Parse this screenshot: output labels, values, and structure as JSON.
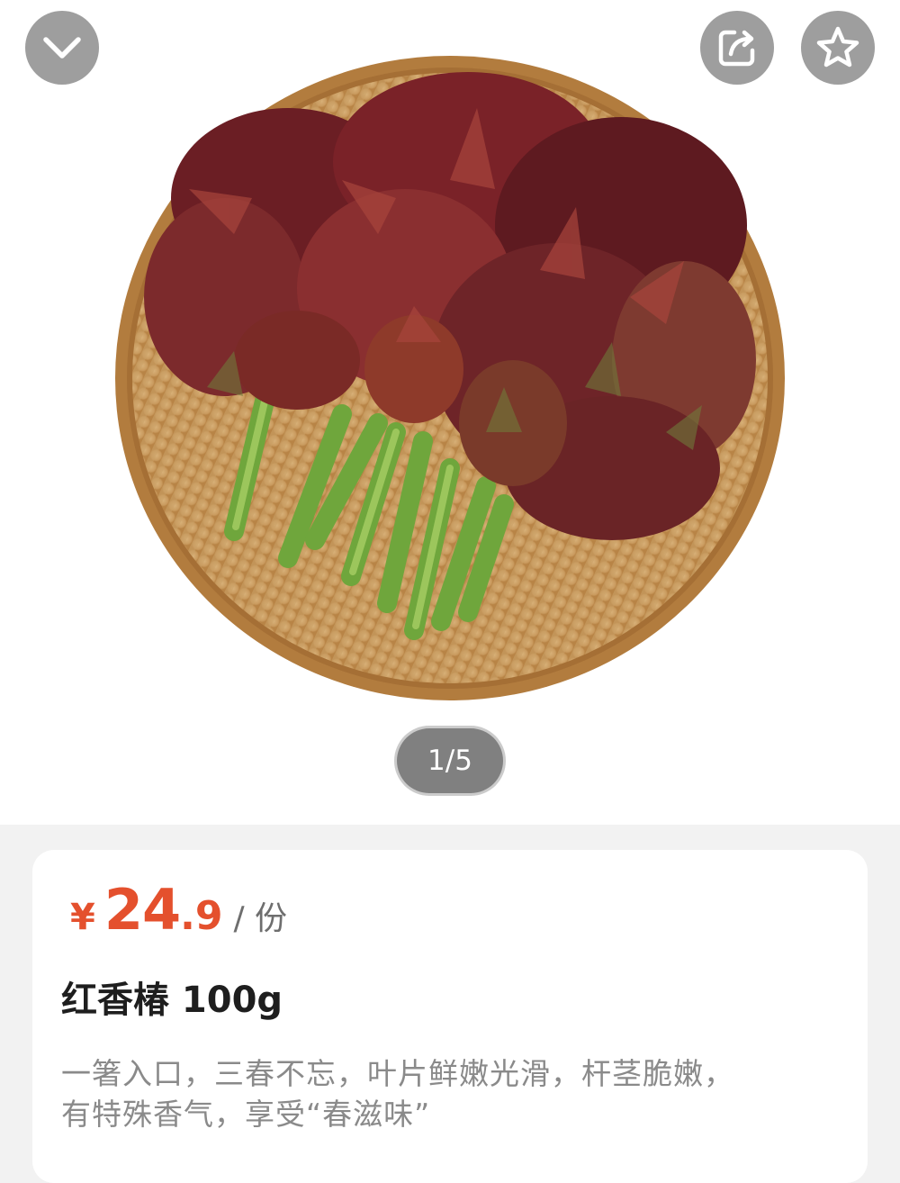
{
  "header": {
    "collapse_icon": "chevron-down-icon",
    "share_icon": "share-icon",
    "favorite_icon": "star-icon"
  },
  "gallery": {
    "page_indicator": "1/5",
    "image_alt": "red toona sprouts in bamboo basket"
  },
  "product": {
    "currency": "¥",
    "price_integer": "24",
    "price_decimal": ".9",
    "unit": "/ 份",
    "title": "红香椿 100g",
    "description_line1": "一箸入口，三春不忘，叶片鲜嫩光滑，杆茎脆嫩，",
    "description_line2": "有特殊香气，享受“春滋味”"
  },
  "colors": {
    "price": "#e4502d",
    "title": "#1e1e1e",
    "description": "#8a8a8a",
    "background": "#f2f2f2"
  }
}
